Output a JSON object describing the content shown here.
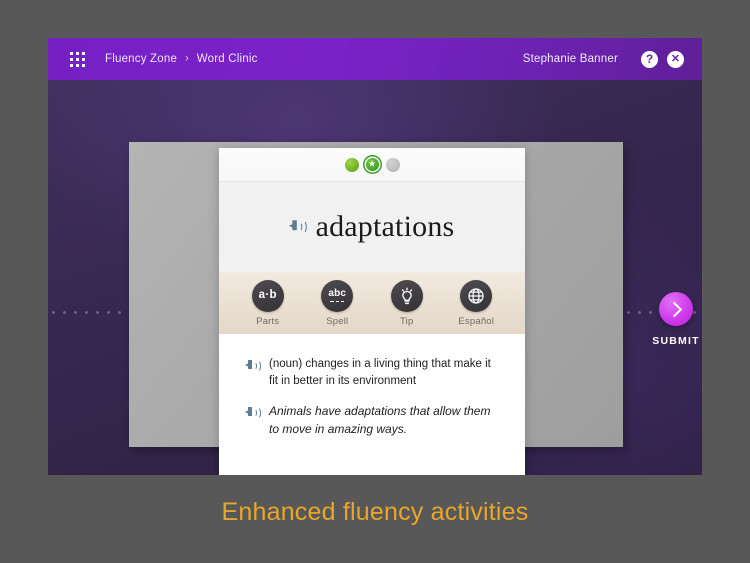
{
  "caption": "Enhanced fluency activities",
  "header": {
    "grid_icon": "grid-apps-icon",
    "breadcrumb": {
      "root": "Fluency Zone",
      "separator": "›",
      "current": "Word Clinic"
    },
    "user_name": "Stephanie Banner",
    "help_label": "?",
    "close_label": "✕"
  },
  "card": {
    "progress": {
      "dots": [
        {
          "state": "done",
          "label": "step-1-complete"
        },
        {
          "state": "current",
          "label": "step-2-current",
          "glyph": "★"
        },
        {
          "state": "todo",
          "label": "step-3-upcoming"
        }
      ]
    },
    "word": "adaptations",
    "word_audio_icon": "speaker-icon",
    "tools": [
      {
        "name": "parts",
        "label": "Parts",
        "icon": "a-dot-b-icon",
        "glyph": "a·b"
      },
      {
        "name": "spell",
        "label": "Spell",
        "icon": "abc-icon",
        "glyph": "abc"
      },
      {
        "name": "tip",
        "label": "Tip",
        "icon": "lightbulb-icon"
      },
      {
        "name": "espanol",
        "label": "Español",
        "icon": "globe-icon"
      }
    ],
    "definition": {
      "audio_icon": "speaker-icon",
      "text": "(noun) changes in a living thing that make it fit in better in its environment"
    },
    "example": {
      "audio_icon": "speaker-icon",
      "text": "Animals have adaptations that allow them to move in amazing ways."
    }
  },
  "submit": {
    "label": "SUBMIT",
    "icon": "chevron-right-icon"
  },
  "colors": {
    "header_purple": "#7620c4",
    "stage_purple": "#35274e",
    "submit_magenta": "#cf3ceb",
    "caption_gold": "#e8a62a",
    "tools_beige": "#eadfd2",
    "progress_green": "#74b72b"
  }
}
